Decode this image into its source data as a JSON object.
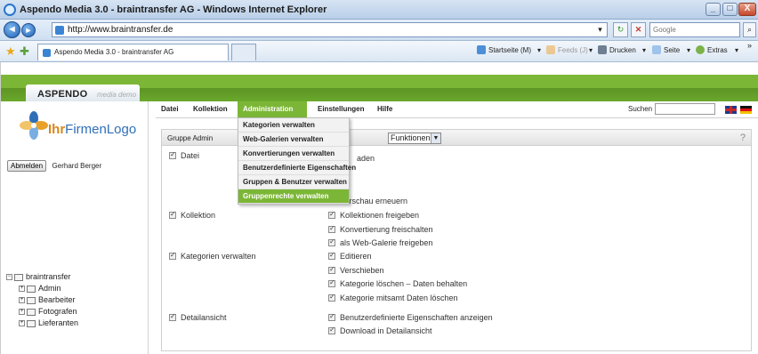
{
  "window": {
    "title": "Aspendo Media 3.0 - braintransfer AG - Windows Internet Explorer",
    "minimize": "_",
    "maximize": "□",
    "close": "X"
  },
  "browser": {
    "back": "◄",
    "forward": "►",
    "url": "http://www.braintransfer.de",
    "search_placeholder": "Google",
    "tab_label": "Aspendo Media 3.0 - braintransfer AG",
    "commands": {
      "startseite": "Startseite (M)",
      "feeds": "Feeds (J)",
      "drucken": "Drucken",
      "seite": "Seite",
      "extras": "Extras"
    }
  },
  "app": {
    "brand": "ASPENDO",
    "brand_sub": "media demo",
    "logo_part1": "Ihr",
    "logo_part2": "FirmenLogo",
    "logout_label": "Abmelden",
    "user_name": "Gerhard Berger"
  },
  "tree": {
    "root": "braintransfer",
    "children": [
      "Admin",
      "Bearbeiter",
      "Fotografen",
      "Lieferanten"
    ]
  },
  "menu": {
    "items": [
      "Datei",
      "Kollektion",
      "Administration",
      "Einstellungen",
      "Hilfe"
    ],
    "active": "Administration",
    "search_label": "Suchen"
  },
  "dropdown": {
    "items": [
      "Kategorien verwalten",
      "Web-Galerien verwalten",
      "Konvertierungen verwalten",
      "Benutzerdefinierte Eigenschaften",
      "Gruppen & Benutzer verwalten",
      "Gruppenrechte verwalten"
    ],
    "active": "Gruppenrechte verwalten"
  },
  "panel": {
    "group_label": "Gruppe Admin",
    "functions_select": "Funktionen",
    "help": "?",
    "groups": [
      "Datei",
      "Kollektion",
      "Kategorien verwalten",
      "Detailansicht"
    ],
    "permissions": [
      "aden",
      "Vorschau erneuern",
      "Kollektionen freigeben",
      "Konvertierung freischalten",
      "als Web-Galerie freigeben",
      "Editieren",
      "Verschieben",
      "Kategorie löschen – Daten behalten",
      "Kategorie mitsamt Daten löschen",
      "Benutzerdefinierte Eigenschaften anzeigen",
      "Download in Detailansicht"
    ]
  },
  "colors": {
    "accent_green": "#7cb636",
    "dark_green": "#5d9524",
    "logo_orange": "#d9861a",
    "logo_blue": "#2f6fb8"
  }
}
